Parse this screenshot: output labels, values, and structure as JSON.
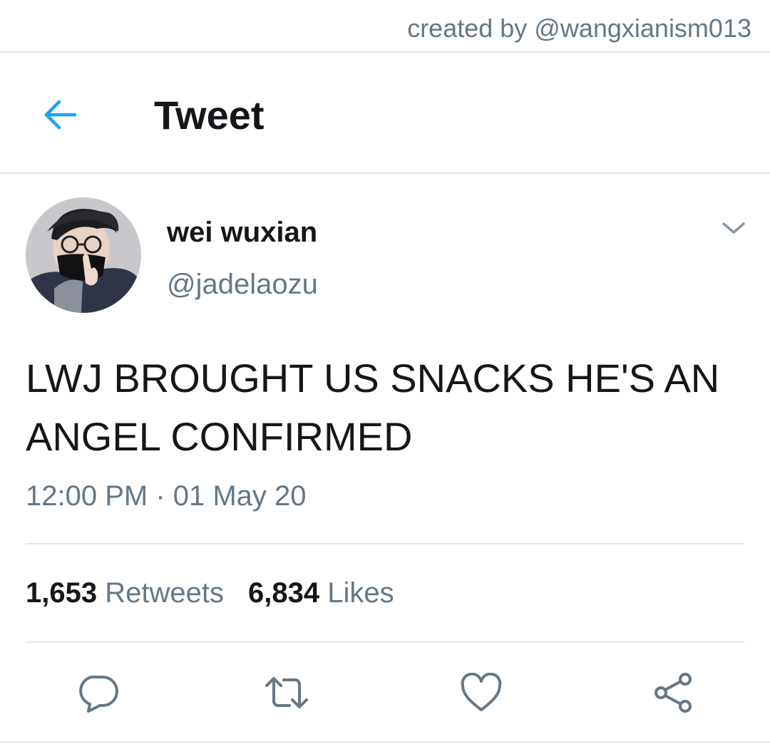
{
  "watermark": {
    "credit": "created by @wangxianism013"
  },
  "header": {
    "title": "Tweet",
    "back_icon": "arrow-left-icon"
  },
  "author": {
    "display_name": "wei wuxian",
    "handle": "@jadelaozu"
  },
  "tweet": {
    "text": "LWJ BROUGHT US SNACKS HE'S AN ANGEL CONFIRMED",
    "timestamp": "12:00 PM · 01 May 20"
  },
  "stats": {
    "retweets_count": "1,653",
    "retweets_label": "Retweets",
    "likes_count": "6,834",
    "likes_label": "Likes"
  },
  "actions": [
    {
      "icon": "reply-icon"
    },
    {
      "icon": "retweet-icon"
    },
    {
      "icon": "heart-icon"
    },
    {
      "icon": "share-icon"
    }
  ],
  "colors": {
    "accent": "#1da1f2",
    "text_primary": "#14171a",
    "text_secondary": "#657786",
    "divider": "#e1e8ed"
  }
}
